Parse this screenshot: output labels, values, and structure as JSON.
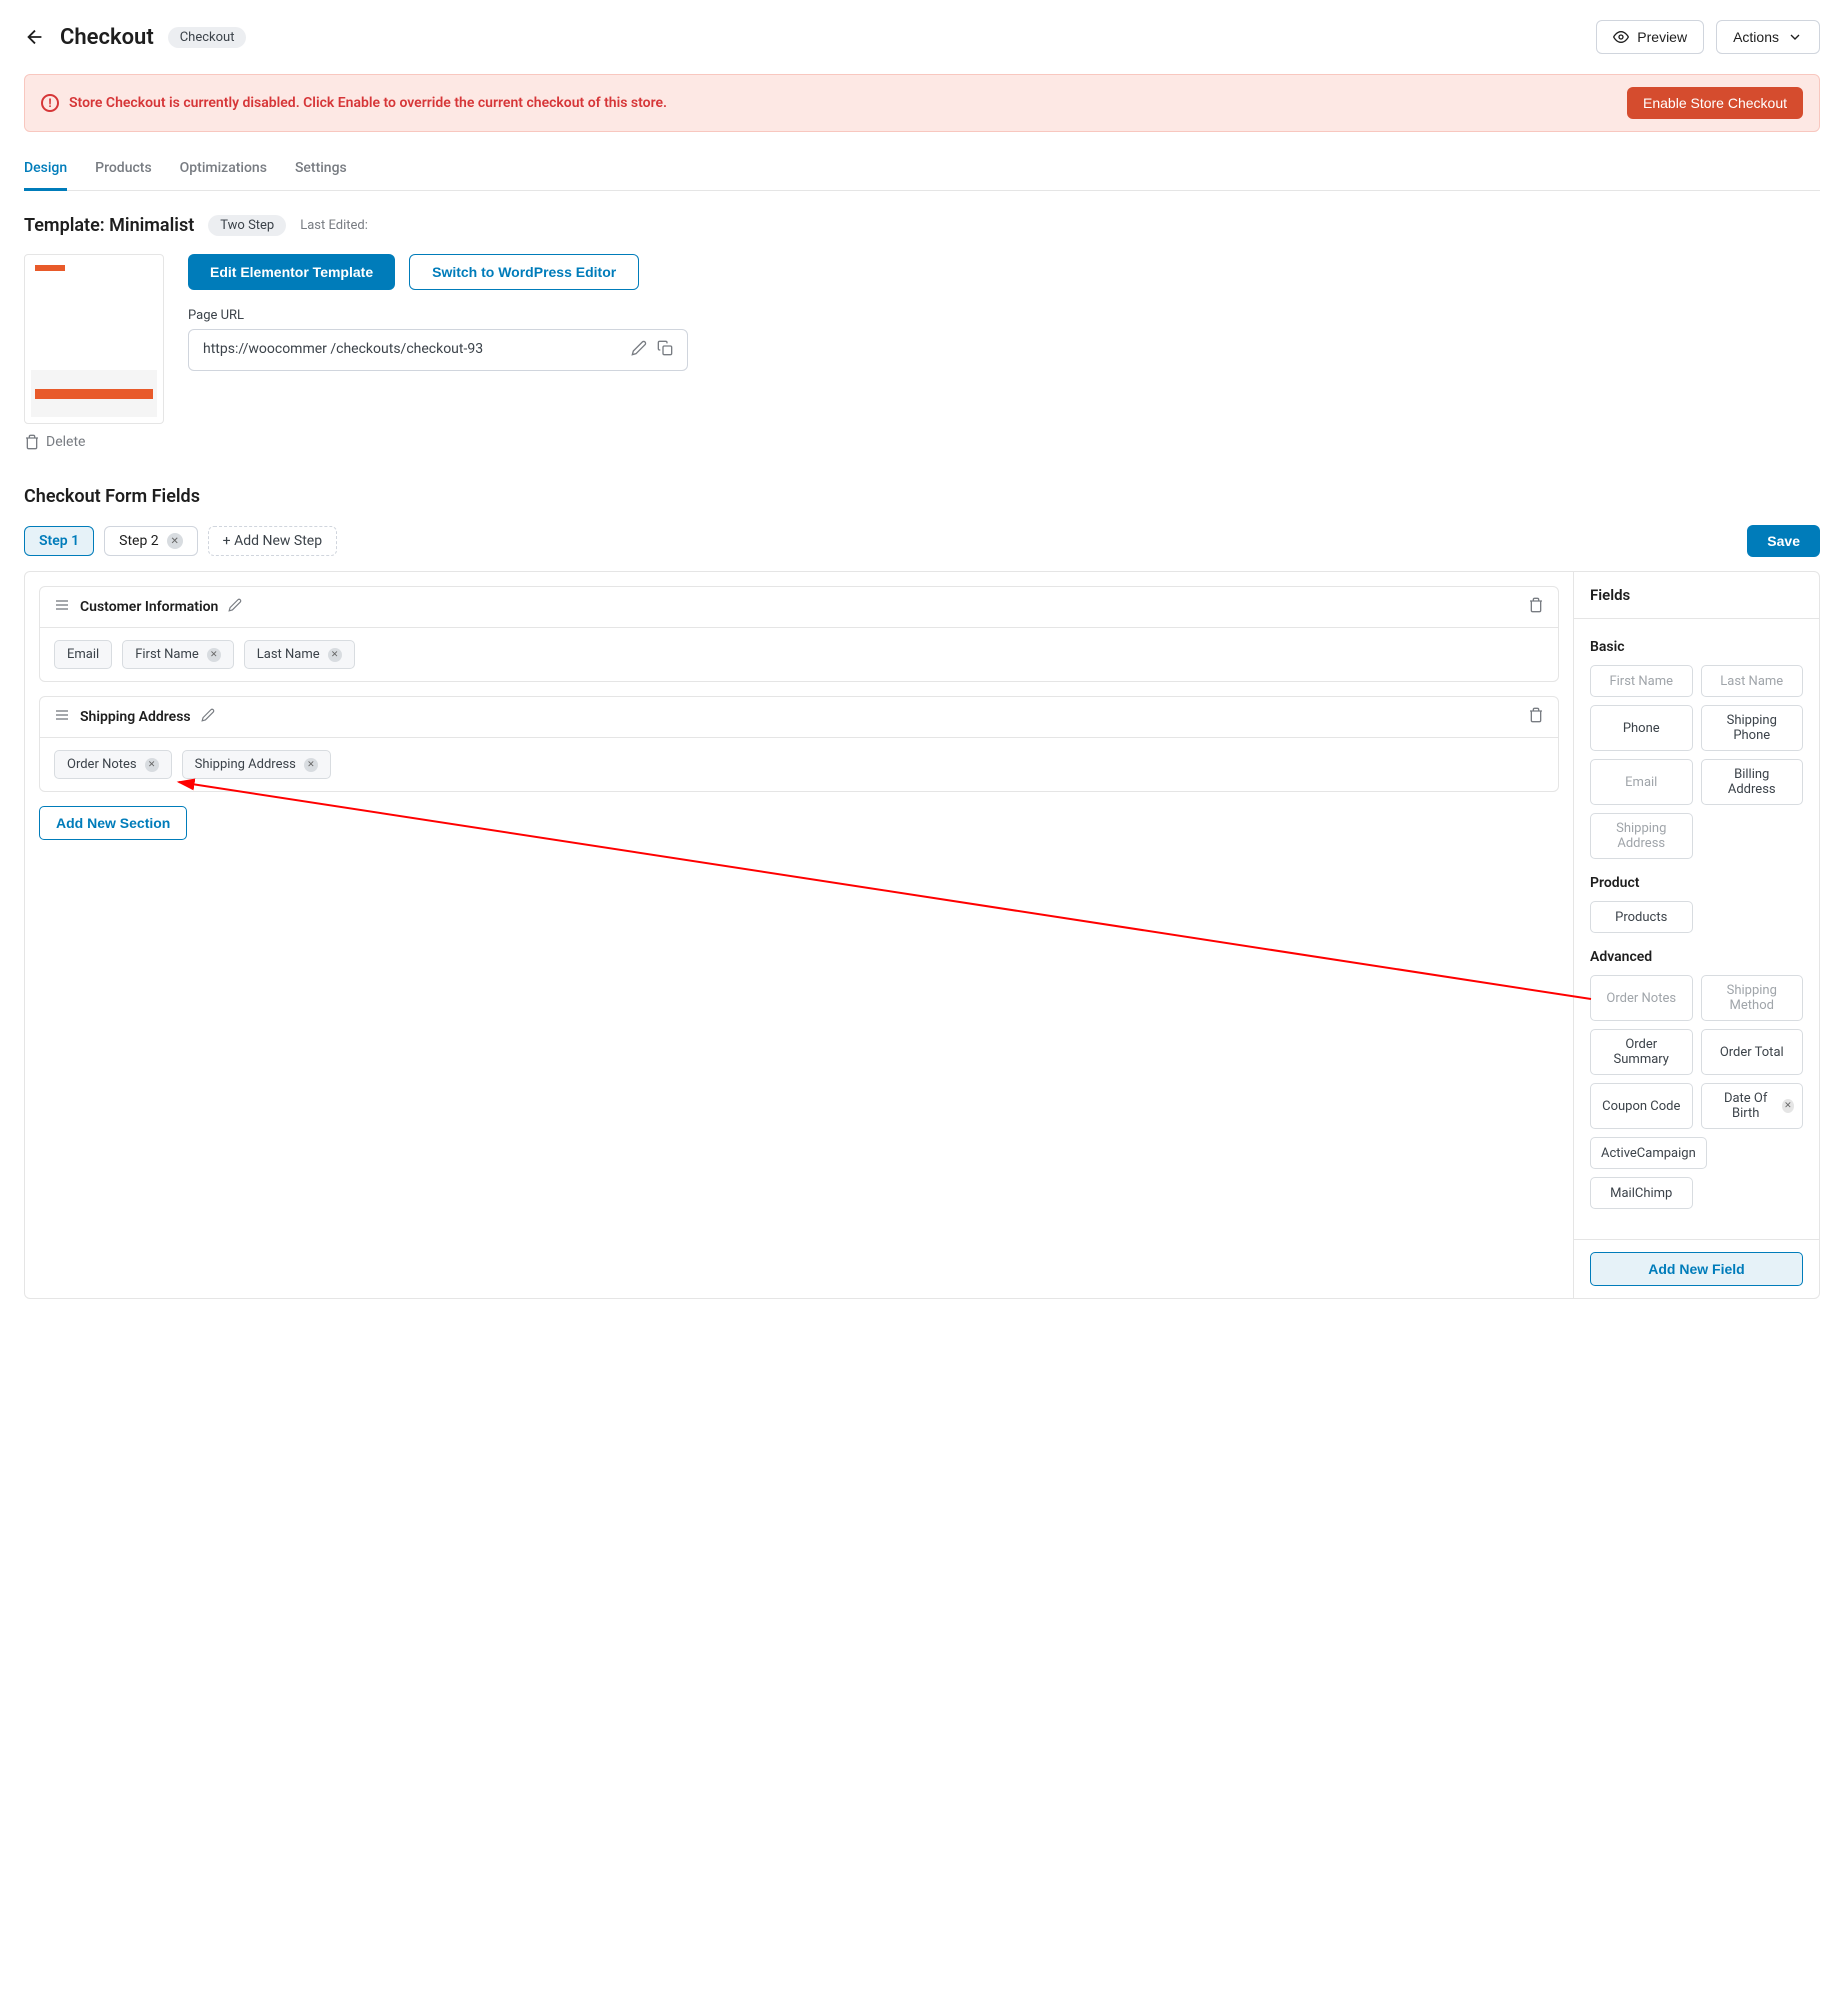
{
  "header": {
    "title": "Checkout",
    "chip": "Checkout",
    "preview": "Preview",
    "actions": "Actions"
  },
  "alert": {
    "message": "Store Checkout is currently disabled. Click Enable to override the current checkout of this store.",
    "button": "Enable Store Checkout"
  },
  "tabs": [
    "Design",
    "Products",
    "Optimizations",
    "Settings"
  ],
  "template": {
    "title": "Template: Minimalist",
    "step_chip": "Two Step",
    "last_edited_label": "Last Edited:",
    "last_edited_value": "                    ",
    "edit_elementor": "Edit Elementor Template",
    "switch_wp": "Switch to WordPress Editor",
    "page_url_label": "Page URL",
    "page_url_value": "https://woocommer                                                     /checkouts/checkout-93",
    "delete": "Delete"
  },
  "form_fields": {
    "title": "Checkout Form Fields",
    "steps": {
      "step1": "Step 1",
      "step2": "Step 2",
      "add": "+ Add New Step"
    },
    "save": "Save",
    "sections": [
      {
        "name": "Customer Information",
        "fields": [
          {
            "label": "Email",
            "removable": false
          },
          {
            "label": "First Name",
            "removable": true
          },
          {
            "label": "Last Name",
            "removable": true
          }
        ]
      },
      {
        "name": "Shipping Address",
        "fields": [
          {
            "label": "Order Notes",
            "removable": true
          },
          {
            "label": "Shipping Address",
            "removable": true
          }
        ]
      }
    ],
    "add_section": "Add New Section"
  },
  "sidebar": {
    "title": "Fields",
    "groups": [
      {
        "title": "Basic",
        "fields": [
          {
            "label": "First Name",
            "disabled": true
          },
          {
            "label": "Last Name",
            "disabled": true
          },
          {
            "label": "Phone",
            "disabled": false
          },
          {
            "label": "Shipping Phone",
            "disabled": false
          },
          {
            "label": "Email",
            "disabled": true
          },
          {
            "label": "Billing Address",
            "disabled": false
          },
          {
            "label": "Shipping Address",
            "disabled": true
          }
        ]
      },
      {
        "title": "Product",
        "fields": [
          {
            "label": "Products",
            "disabled": false
          }
        ]
      },
      {
        "title": "Advanced",
        "fields": [
          {
            "label": "Order Notes",
            "disabled": true
          },
          {
            "label": "Shipping Method",
            "disabled": true
          },
          {
            "label": "Order Summary",
            "disabled": false
          },
          {
            "label": "Order Total",
            "disabled": false
          },
          {
            "label": "Coupon Code",
            "disabled": false
          },
          {
            "label": "Date Of Birth",
            "disabled": false,
            "removable": true
          },
          {
            "label": "ActiveCampaign",
            "disabled": false
          },
          {
            "label": "MailChimp",
            "disabled": false
          }
        ]
      }
    ],
    "add_field": "Add New Field"
  }
}
